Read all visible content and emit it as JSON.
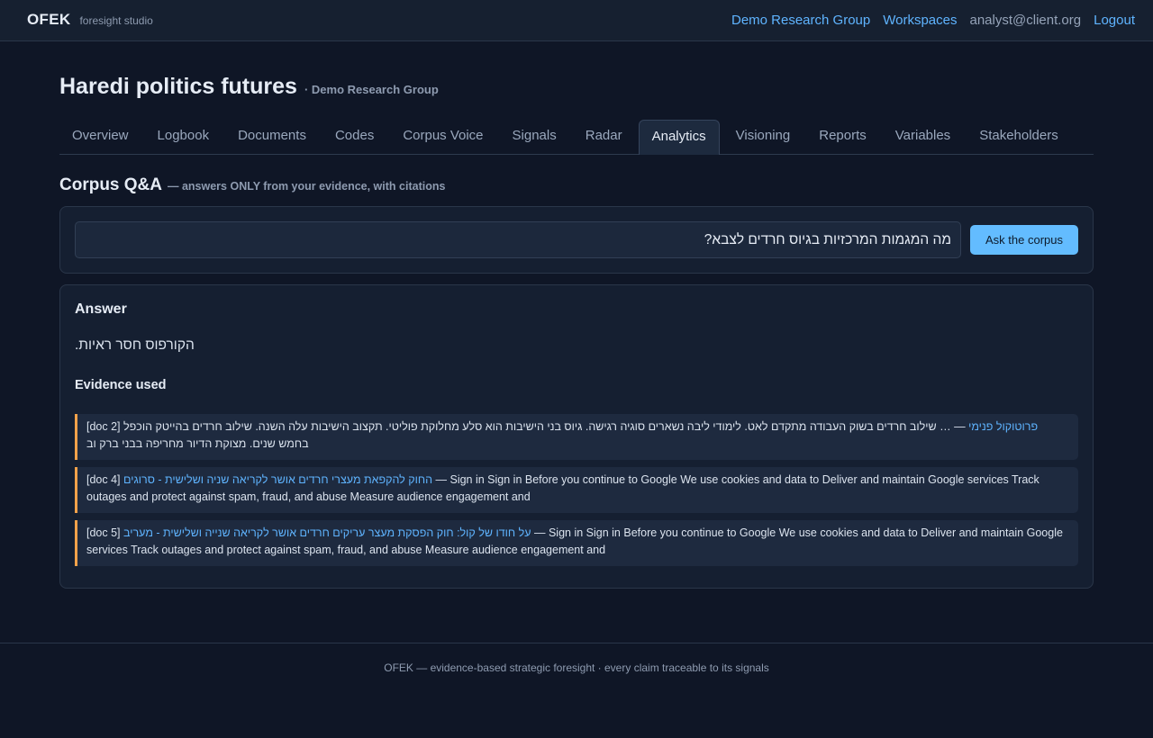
{
  "brand": {
    "name": "OFEK",
    "tagline": "foresight studio"
  },
  "topnav": {
    "group": "Demo Research Group",
    "workspaces": "Workspaces",
    "user": "analyst@client.org",
    "logout": "Logout"
  },
  "page": {
    "title": "Haredi politics futures",
    "subtitle": "· Demo Research Group"
  },
  "tabs": [
    {
      "label": "Overview"
    },
    {
      "label": "Logbook"
    },
    {
      "label": "Documents"
    },
    {
      "label": "Codes"
    },
    {
      "label": "Corpus Voice"
    },
    {
      "label": "Signals"
    },
    {
      "label": "Radar"
    },
    {
      "label": "Analytics",
      "active": true
    },
    {
      "label": "Visioning"
    },
    {
      "label": "Reports"
    },
    {
      "label": "Variables"
    },
    {
      "label": "Stakeholders"
    }
  ],
  "section": {
    "title": "Corpus Q&A",
    "subtitle": "— answers ONLY from your evidence, with citations"
  },
  "ask": {
    "query": "מה המגמות המרכזיות בגיוס חרדים לצבא?",
    "button": "Ask the corpus"
  },
  "answer": {
    "label": "Answer",
    "text": "הקורפוס חסר ראיות.",
    "evidence_label": "Evidence used",
    "evidence": [
      {
        "tag": "[doc 2]",
        "title": "פרוטוקול פנימי",
        "snippet": "— … שילוב חרדים בשוק העבודה מתקדם לאט. לימודי ליבה נשארים סוגיה רגישה. גיוס בני הישיבות הוא סלע מחלוקת פוליטי. תקצוב הישיבות עלה השנה. שילוב חרדים בהייטק הוכפל בחמש שנים. מצוקת הדיור מחריפה בבני ברק וב"
      },
      {
        "tag": "[doc 4]",
        "title": "החוק להקפאת מעצרי חרדים אושר לקריאה שניה ושלישית - סרוגים",
        "snippet": "— Sign in Sign in Before you continue to Google We use cookies and data to Deliver and maintain Google services Track outages and protect against spam, fraud, and abuse Measure audience engagement and"
      },
      {
        "tag": "[doc 5]",
        "title": "על חודו של קול: חוק הפסקת מעצר עריקים חרדים אושר לקריאה שנייה ושלישית - מעריב",
        "snippet": "— Sign in Sign in Before you continue to Google We use cookies and data to Deliver and maintain Google services Track outages and protect against spam, fraud, and abuse Measure audience engagement and"
      }
    ]
  },
  "footer": {
    "text": "OFEK — evidence-based strategic foresight · every claim traceable to its signals"
  },
  "colors": {
    "accent": "#5fb4ff",
    "button": "#63bcff",
    "evidence_border": "#f3a24a",
    "background": "#0f1626"
  }
}
